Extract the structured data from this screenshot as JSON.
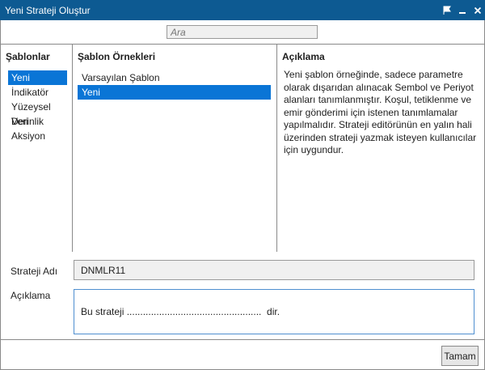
{
  "window": {
    "title": "Yeni Strateji Oluştur",
    "controls": {
      "pin_icon": "pin-icon",
      "minimize_icon": "minimize-icon",
      "close_icon": "close-icon"
    }
  },
  "search": {
    "placeholder": "Ara"
  },
  "templates_panel": {
    "header": "Şablonlar",
    "items": [
      {
        "label": "Yeni",
        "selected": true
      },
      {
        "label": "İndikatör",
        "selected": false
      },
      {
        "label": "Yüzeysel Veri",
        "selected": false
      },
      {
        "label": "Derinlik",
        "selected": false
      },
      {
        "label": "Aksiyon",
        "selected": false
      }
    ]
  },
  "examples_panel": {
    "header": "Şablon Örnekleri",
    "items": [
      {
        "label": "Varsayılan Şablon",
        "selected": false
      },
      {
        "label": "Yeni",
        "selected": true
      }
    ]
  },
  "description_panel": {
    "header": "Açıklama",
    "text": "Yeni şablon örneğinde, sadece parametre olarak dışarıdan alınacak Sembol ve Periyot alanları tanımlanmıştır. Koşul, tetiklenme ve emir gönderimi için istenen tanımlamalar yapılmalıdır. Strateji editörünün en yalın hali üzerinden strateji yazmak isteyen kullanıcılar için uygundur."
  },
  "form": {
    "name_label": "Strateji Adı",
    "name_value": "DNMLR11",
    "desc_label": "Açıklama",
    "desc_value": "Bu strateji ..................................................  dir."
  },
  "buttons": {
    "ok_label": "Tamam"
  },
  "colors": {
    "titlebar": "#0d5a92",
    "selection": "#0a75d6",
    "focus_border": "#4f8fd0"
  }
}
